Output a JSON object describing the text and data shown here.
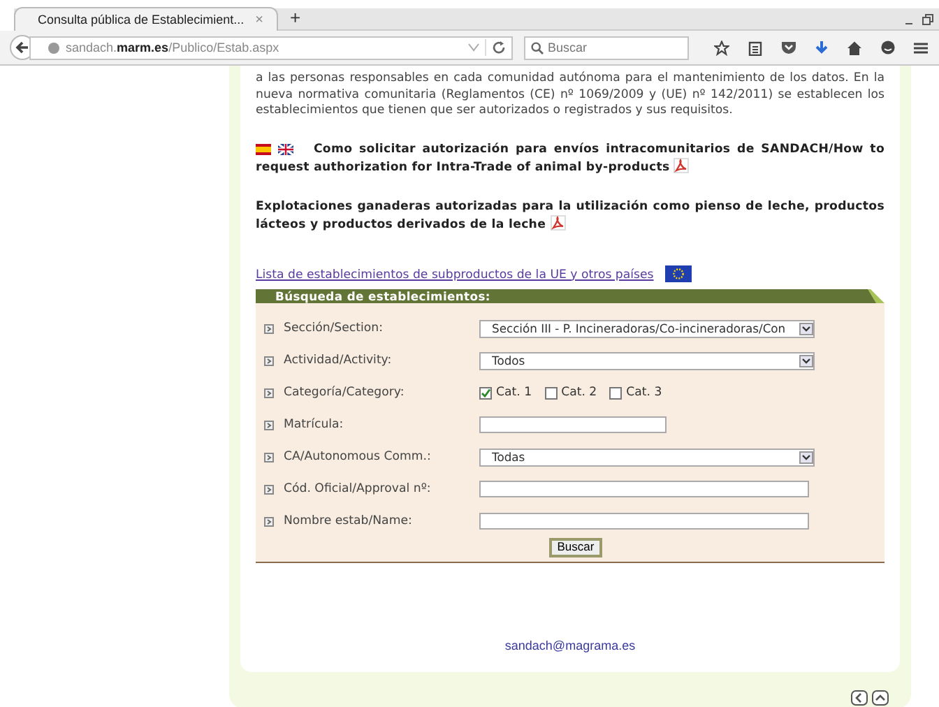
{
  "browser": {
    "tab_title": "Consulta pública de Establecimient...",
    "tab_close": "×",
    "new_tab": "+",
    "url": "sandach.**marm.es**/Publico/Estab.aspx",
    "search_placeholder": "Buscar"
  },
  "page": {
    "intro": "a las personas responsables en cada comunidad autónoma para el mantenimiento de los datos. En la nueva normativa comunitaria (Reglamentos (CE) nº 1069/2009 y (UE) nº 142/2011) se establecen los establecimientos que tienen que ser autorizados o registrados y sus requisitos.",
    "documents": [
      {
        "text": "Como solicitar autorización para envíos intracomunitarios de SANDACH/How to request authorization for Intra-Trade of animal by-products",
        "flags": true
      },
      {
        "text": "Explotaciones ganaderas autorizadas para la utilización como pienso de leche, productos lácteos y productos derivados de la leche",
        "flags": false
      }
    ],
    "eu_link": "Lista de establecimientos de subproductos de la UE y otros países",
    "form": {
      "title": "Búsqueda de establecimientos:",
      "rows": [
        {
          "kind": "select",
          "label": "Sección/Section:",
          "value": "Sección III - P. Incineradoras/Co-incineradoras/Con"
        },
        {
          "kind": "select",
          "label": "Actividad/Activity:",
          "value": "Todos"
        },
        {
          "kind": "checks",
          "label": "Categoría/Category:",
          "options": [
            {
              "label": "Cat. 1",
              "checked": true
            },
            {
              "label": "Cat. 2",
              "checked": false
            },
            {
              "label": "Cat. 3",
              "checked": false
            }
          ]
        },
        {
          "kind": "short_text",
          "label": "Matrícula:"
        },
        {
          "kind": "select",
          "label": "CA/Autonomous Comm.:",
          "value": "Todas"
        },
        {
          "kind": "text",
          "label": "Cód. Oficial/Approval nº:"
        },
        {
          "kind": "text",
          "label": "Nombre estab/Name:"
        }
      ],
      "button": "Buscar"
    },
    "email": "sandach@magrama.es"
  }
}
